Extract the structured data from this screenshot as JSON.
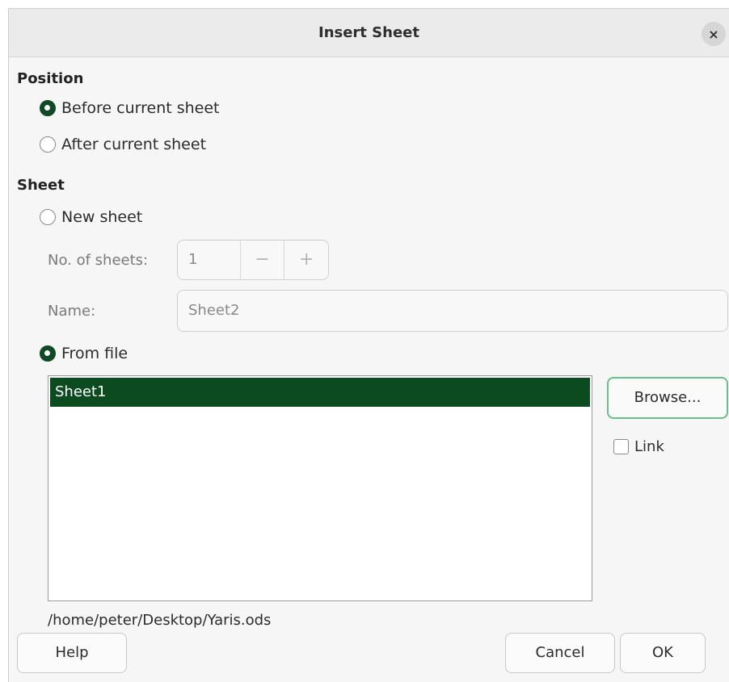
{
  "window": {
    "title": "Insert Sheet",
    "close_glyph": "×"
  },
  "position": {
    "label": "Position",
    "options": [
      {
        "label": "Before current sheet",
        "checked": true
      },
      {
        "label": "After current sheet",
        "checked": false
      }
    ]
  },
  "sheet": {
    "label": "Sheet",
    "new_sheet": {
      "label": "New sheet",
      "checked": false
    },
    "num_sheets": {
      "label": "No. of sheets:",
      "value": "1",
      "minus": "−",
      "plus": "+"
    },
    "name": {
      "label": "Name:",
      "value": "Sheet2"
    },
    "from_file": {
      "label": "From file",
      "checked": true
    },
    "sheet_list": [
      "Sheet1"
    ],
    "browse_label": "Browse...",
    "link_label": "Link",
    "file_path": "/home/peter/Desktop/Yaris.ods"
  },
  "buttons": {
    "help": "Help",
    "cancel": "Cancel",
    "ok": "OK"
  },
  "colors": {
    "accent": "#0f4a24",
    "focus_border": "#68c08a"
  }
}
